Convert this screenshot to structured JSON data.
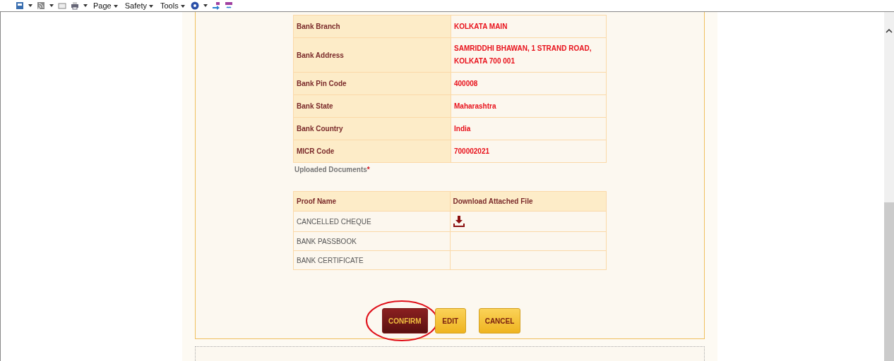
{
  "toolbar": {
    "menus": [
      {
        "label": "Page"
      },
      {
        "label": "Safety"
      },
      {
        "label": "Tools"
      }
    ]
  },
  "bank_details": [
    {
      "label": "Bank Branch",
      "value": "KOLKATA MAIN"
    },
    {
      "label": "Bank Address",
      "value": "SAMRIDDHI BHAWAN, 1 STRAND ROAD, KOLKATA 700 001"
    },
    {
      "label": "Bank Pin Code",
      "value": "400008"
    },
    {
      "label": "Bank State",
      "value": "Maharashtra"
    },
    {
      "label": "Bank Country",
      "value": "India"
    },
    {
      "label": "MICR Code",
      "value": "700002021"
    }
  ],
  "documents": {
    "title": "Uploaded Documents",
    "required_mark": "*",
    "columns": [
      "Proof Name",
      "Download Attached File"
    ],
    "rows": [
      {
        "name": "CANCELLED CHEQUE",
        "has_file": true
      },
      {
        "name": "BANK PASSBOOK",
        "has_file": false
      },
      {
        "name": "BANK CERTIFICATE",
        "has_file": false
      }
    ]
  },
  "buttons": [
    {
      "label": "CONFIRM",
      "highlighted": true
    },
    {
      "label": "EDIT",
      "highlighted": false
    },
    {
      "label": "CANCEL",
      "highlighted": false
    }
  ]
}
